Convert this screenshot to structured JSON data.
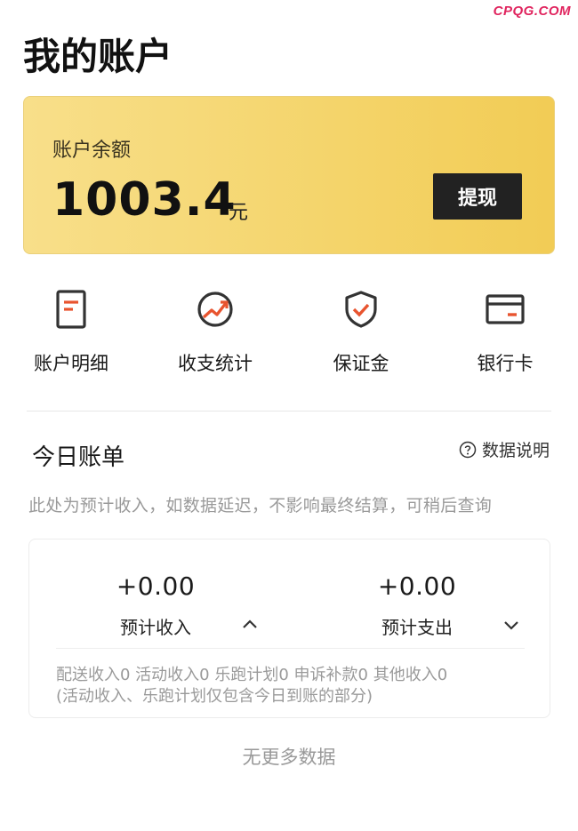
{
  "watermark": "CPQG.COM",
  "page": {
    "title": "我的账户"
  },
  "balance": {
    "label": "账户余额",
    "amount": "1003.4",
    "unit": "元",
    "withdraw_label": "提现"
  },
  "quick_actions": [
    {
      "label": "账户明细",
      "icon": "document-icon"
    },
    {
      "label": "收支统计",
      "icon": "trend-chart-icon"
    },
    {
      "label": "保证金",
      "icon": "shield-check-icon"
    },
    {
      "label": "银行卡",
      "icon": "bank-card-icon"
    }
  ],
  "bill": {
    "title": "今日账单",
    "help_label": "数据说明",
    "note": "此处为预计收入，如数据延迟，不影响最终结算，可稍后查询",
    "income": {
      "value": "+0.00",
      "label": "预计收入"
    },
    "expense": {
      "value": "+0.00",
      "label": "预计支出"
    },
    "detail_line1": "配送收入0 活动收入0 乐跑计划0 申诉补款0 其他收入0",
    "detail_line2": "(活动收入、乐跑计划仅包含今日到账的部分)"
  },
  "footer": {
    "no_more": "无更多数据"
  },
  "colors": {
    "accent_orange": "#e8542f",
    "icon_dark": "#333333",
    "card_gold": "#f4d46a"
  }
}
